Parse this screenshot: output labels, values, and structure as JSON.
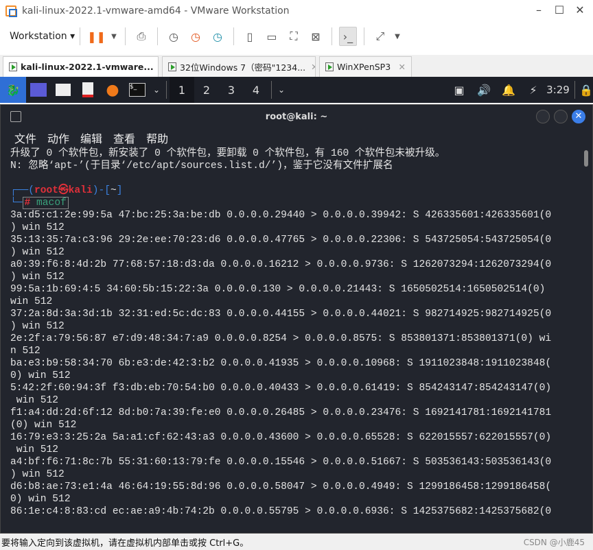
{
  "window": {
    "title": "kali-linux-2022.1-vmware-amd64 - VMware Workstation"
  },
  "toolbar": {
    "workstation_label": "Workstation"
  },
  "tabs": [
    {
      "label": "kali-linux-2022.1-vmware...",
      "active": true
    },
    {
      "label": "32位Windows 7（密码\"1234...",
      "active": false
    },
    {
      "label": "WinXPenSP3",
      "active": false
    }
  ],
  "kali_panel": {
    "workspaces": [
      "1",
      "2",
      "3",
      "4"
    ],
    "clock": "3:29"
  },
  "terminal": {
    "title": "root@kali: ~",
    "menu": [
      "文件",
      "动作",
      "编辑",
      "查看",
      "帮助"
    ],
    "pre_lines": [
      "升级了 0 个软件包，新安装了 0 个软件包，要卸载 0 个软件包，有 160 个软件包未被升级。",
      "N: 忽略‘apt-’(于目录‘/etc/apt/sources.list.d/’)，鉴于它没有文件扩展名"
    ],
    "prompt": {
      "user": "root",
      "at": "㉿",
      "host": "kali",
      "dir": "~",
      "hash": "#",
      "command": "macof"
    },
    "output_lines": [
      "3a:d5:c1:2e:99:5a 47:bc:25:3a:be:db 0.0.0.0.29440 > 0.0.0.0.39942: S 426335601:426335601(0",
      ") win 512",
      "35:13:35:7a:c3:96 29:2e:ee:70:23:d6 0.0.0.0.47765 > 0.0.0.0.22306: S 543725054:543725054(0",
      ") win 512",
      "a0:39:f6:8:4d:2b 77:68:57:18:d3:da 0.0.0.0.16212 > 0.0.0.0.9736: S 1262073294:1262073294(0",
      ") win 512",
      "99:5a:1b:69:4:5 34:60:5b:15:22:3a 0.0.0.0.130 > 0.0.0.0.21443: S 1650502514:1650502514(0)",
      "win 512",
      "37:2a:8d:3a:3d:1b 32:31:ed:5c:dc:83 0.0.0.0.44155 > 0.0.0.0.44021: S 982714925:982714925(0",
      ") win 512",
      "2e:2f:a:79:56:87 e7:d9:48:34:7:a9 0.0.0.0.8254 > 0.0.0.0.8575: S 853801371:853801371(0) wi",
      "n 512",
      "ba:e3:b9:58:34:70 6b:e3:de:42:3:b2 0.0.0.0.41935 > 0.0.0.0.10968: S 1911023848:1911023848(",
      "0) win 512",
      "5:42:2f:60:94:3f f3:db:eb:70:54:b0 0.0.0.0.40433 > 0.0.0.0.61419: S 854243147:854243147(0)",
      " win 512",
      "f1:a4:dd:2d:6f:12 8d:b0:7a:39:fe:e0 0.0.0.0.26485 > 0.0.0.0.23476: S 1692141781:1692141781",
      "(0) win 512",
      "16:79:e3:3:25:2a 5a:a1:cf:62:43:a3 0.0.0.0.43600 > 0.0.0.0.65528: S 622015557:622015557(0)",
      " win 512",
      "a4:bf:f6:71:8c:7b 55:31:60:13:79:fe 0.0.0.0.15546 > 0.0.0.0.51667: S 503536143:503536143(0",
      ") win 512",
      "d6:b8:ae:73:e1:4a 46:64:19:55:8d:96 0.0.0.0.58047 > 0.0.0.0.4949: S 1299186458:1299186458(",
      "0) win 512",
      "86:1e:c4:8:83:cd ec:ae:a9:4b:74:2b 0.0.0.0.55795 > 0.0.0.0.6936: S 1425375682:1425375682(0"
    ]
  },
  "status": {
    "message": "要将输入定向到该虚拟机，请在虚拟机内部单击或按 Ctrl+G。",
    "watermark": "CSDN @小鹿45"
  },
  "colors": {
    "terminal_bg": "#22252d",
    "panel_bg": "#1d2028",
    "prompt_red": "#e0303a",
    "prompt_blue": "#3b82e0",
    "command_green": "#3aa37c",
    "pause_orange": "#f06a1a"
  }
}
